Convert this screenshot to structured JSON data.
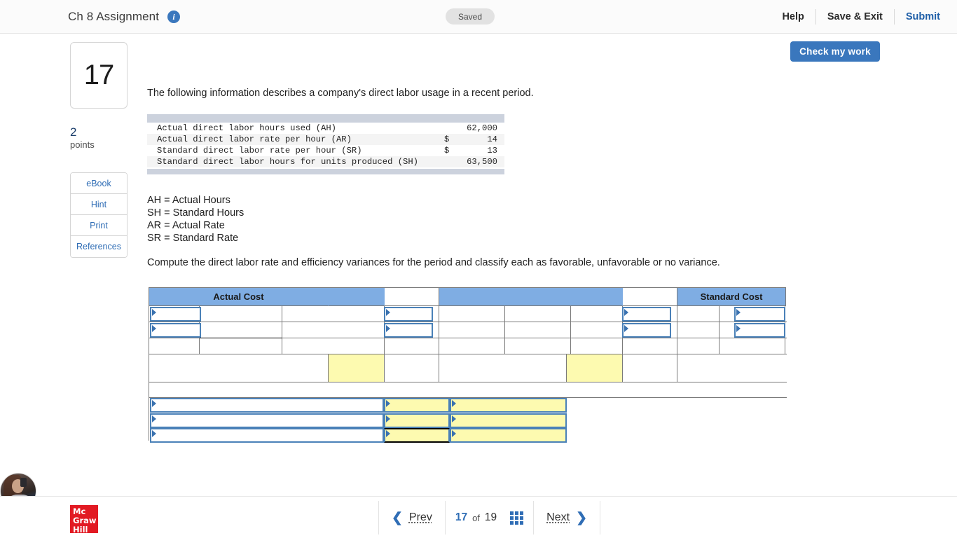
{
  "header": {
    "assignment_title": "Ch 8 Assignment",
    "info_icon": "info-icon",
    "saved_badge": "Saved",
    "help_label": "Help",
    "save_exit_label": "Save & Exit",
    "submit_label": "Submit",
    "check_work_label": "Check my work",
    "accent_color": "#3a77bd",
    "link_color": "#1f5fa8"
  },
  "left_rail": {
    "question_number": "17",
    "points_value": "2",
    "points_label": "points",
    "tools": [
      {
        "label": "eBook"
      },
      {
        "label": "Hint"
      },
      {
        "label": "Print"
      },
      {
        "label": "References"
      }
    ]
  },
  "question": {
    "intro": "The following information describes a company's direct labor usage in a recent period.",
    "fact_table": {
      "rows": [
        {
          "label": "Actual direct labor hours used (AH)",
          "currency": "",
          "value": "62,000"
        },
        {
          "label": "Actual direct labor rate per hour (AR)",
          "currency": "$",
          "value": "14"
        },
        {
          "label": "Standard direct labor rate per hour (SR)",
          "currency": "$",
          "value": "13"
        },
        {
          "label": "Standard direct labor hours for units produced (SH)",
          "currency": "",
          "value": "63,500"
        }
      ]
    },
    "definitions": [
      "AH = Actual Hours",
      "SH = Standard Hours",
      "AR = Actual Rate",
      "SR = Standard Rate"
    ],
    "prompt": "Compute the direct labor rate and efficiency variances for the period and classify each as favorable, unfavorable or no variance."
  },
  "answer_grid": {
    "header_actual_cost": "Actual Cost",
    "header_standard_cost": "Standard Cost",
    "header_fill_color": "#7fade3",
    "input_border_color": "#4a81b8",
    "input_highlight_color": "#fdfab0",
    "dropdown_cells_empty_value": "",
    "rows": [
      {
        "name": "header-row",
        "cells": [
          "Actual Cost",
          "",
          "",
          "Standard Cost"
        ]
      },
      {
        "name": "input-row-1",
        "cells": [
          "",
          "",
          "",
          "",
          "",
          "",
          "",
          "",
          ""
        ]
      },
      {
        "name": "input-row-2",
        "cells": [
          "",
          "",
          "",
          "",
          "",
          "",
          "",
          "",
          ""
        ]
      },
      {
        "name": "subtotal-row",
        "cells": [
          "",
          "",
          "",
          "",
          "",
          "",
          "",
          "",
          ""
        ]
      },
      {
        "name": "variance-row",
        "cells": [
          "",
          "",
          "",
          "",
          ""
        ]
      },
      {
        "name": "spacer-row",
        "cells": [
          ""
        ]
      },
      {
        "name": "result-row-1",
        "cells": [
          "",
          "",
          ""
        ]
      },
      {
        "name": "result-row-2",
        "cells": [
          "",
          "",
          ""
        ]
      },
      {
        "name": "result-row-3",
        "cells": [
          "",
          "",
          ""
        ]
      }
    ]
  },
  "footer": {
    "logo_line1": "Mc",
    "logo_line2": "Graw",
    "logo_line3": "Hill",
    "prev_label": "Prev",
    "next_label": "Next",
    "current_page": "17",
    "of_label": "of",
    "total_pages": "19",
    "grid_view_icon": "grid-view-icon",
    "prev_icon": "chevron-left-icon",
    "next_icon": "chevron-right-icon",
    "webcam_icon": "webcam-thumbnail"
  }
}
